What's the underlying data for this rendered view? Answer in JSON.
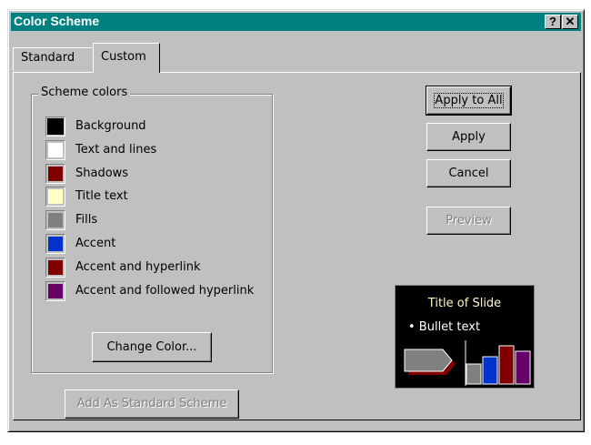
{
  "window": {
    "title": "Color Scheme"
  },
  "titlebar": {
    "help_label": "?",
    "close_label": "✕"
  },
  "tabs": [
    {
      "label": "Standard",
      "active": false
    },
    {
      "label": "Custom",
      "active": true
    }
  ],
  "scheme_colors": {
    "label": "Scheme colors",
    "items": [
      {
        "label": "Background",
        "color": "#000000",
        "selected": true
      },
      {
        "label": "Text and lines",
        "color": "#ffffff"
      },
      {
        "label": "Shadows",
        "color": "#800000"
      },
      {
        "label": "Title text",
        "color": "#ffffc8"
      },
      {
        "label": "Fills",
        "color": "#808080"
      },
      {
        "label": "Accent",
        "color": "#0033cc"
      },
      {
        "label": "Accent and hyperlink",
        "color": "#800000"
      },
      {
        "label": "Accent and followed hyperlink",
        "color": "#660066"
      }
    ],
    "change_color_label": "Change Color..."
  },
  "add_standard_label": "Add As Standard Scheme",
  "buttons": {
    "apply_all": "Apply to All",
    "apply": "Apply",
    "cancel": "Cancel",
    "preview": "Preview"
  },
  "preview_slide": {
    "title": "Title of Slide",
    "bullet": "• Bullet text",
    "bar_colors": [
      "#808080",
      "#0033cc",
      "#800000",
      "#660066"
    ]
  }
}
